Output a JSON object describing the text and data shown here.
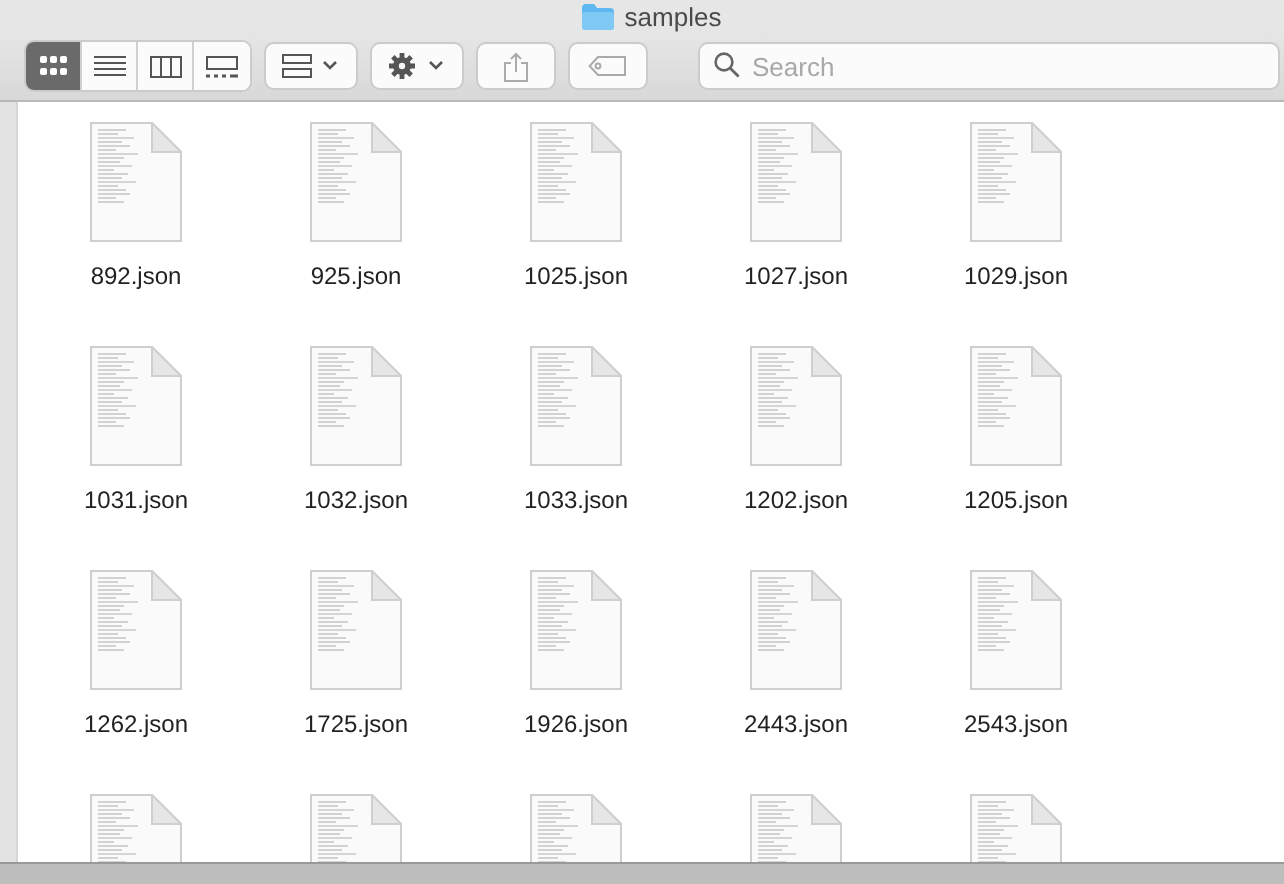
{
  "window": {
    "title": "samples"
  },
  "toolbar": {
    "view_modes": [
      {
        "selected": true
      },
      {
        "selected": false
      },
      {
        "selected": false
      },
      {
        "selected": false
      }
    ],
    "search": {
      "placeholder": "Search"
    }
  },
  "files": [
    {
      "kind": "document",
      "name": "892.json"
    },
    {
      "kind": "document",
      "name": "925.json"
    },
    {
      "kind": "document",
      "name": "1025.json"
    },
    {
      "kind": "document",
      "name": "1027.json"
    },
    {
      "kind": "document",
      "name": "1029.json"
    },
    {
      "kind": "document",
      "name": "1031.json"
    },
    {
      "kind": "document",
      "name": "1032.json"
    },
    {
      "kind": "document",
      "name": "1033.json"
    },
    {
      "kind": "document",
      "name": "1202.json"
    },
    {
      "kind": "document",
      "name": "1205.json"
    },
    {
      "kind": "document",
      "name": "1262.json"
    },
    {
      "kind": "document",
      "name": "1725.json"
    },
    {
      "kind": "document",
      "name": "1926.json"
    },
    {
      "kind": "document",
      "name": "2443.json"
    },
    {
      "kind": "document",
      "name": "2543.json"
    },
    {
      "kind": "document"
    },
    {
      "kind": "document"
    },
    {
      "kind": "document"
    },
    {
      "kind": "document"
    },
    {
      "kind": "document"
    }
  ]
}
